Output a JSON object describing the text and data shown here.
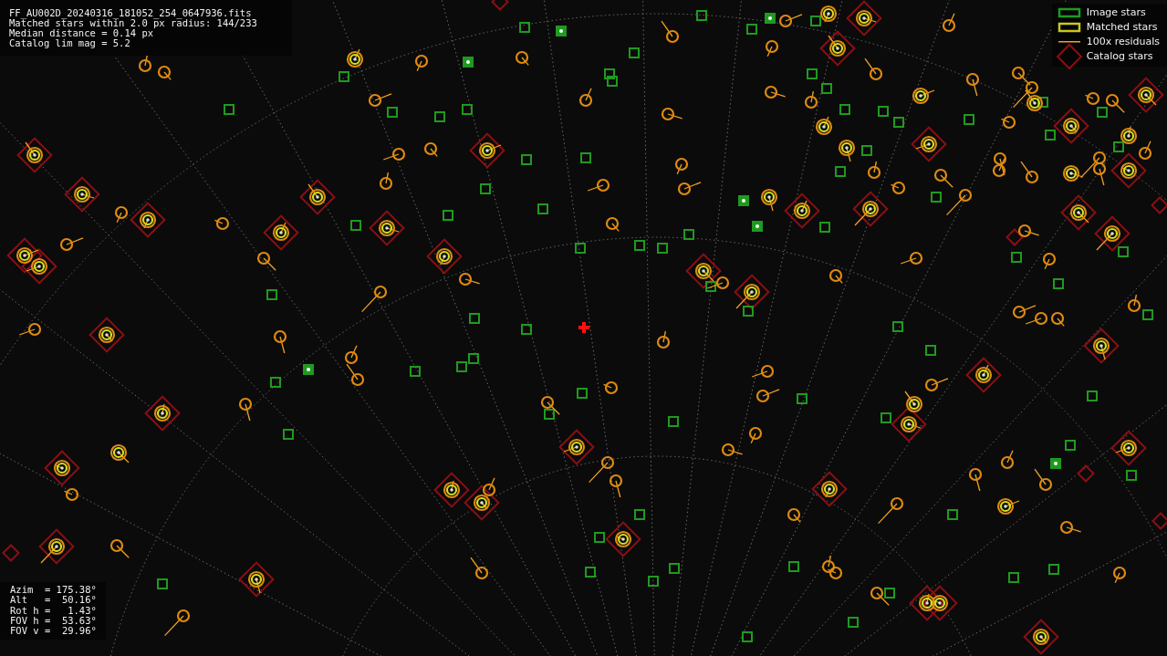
{
  "info_panel": {
    "lines": [
      "FF_AU002D_20240316_181052_254_0647936.fits",
      "Matched stars within 2.0 px radius: 144/233",
      "Median distance = 0.14 px",
      "Catalog lim mag = 5.2"
    ]
  },
  "legend": [
    {
      "kind": "image",
      "label": "Image stars"
    },
    {
      "kind": "matched",
      "label": "Matched stars"
    },
    {
      "kind": "residual",
      "label": "100x residuals"
    },
    {
      "kind": "catalog",
      "label": "Catalog stars"
    }
  ],
  "pointing_panel": {
    "lines": [
      "Azim  = 175.38°",
      "Alt   =  50.16°",
      "Rot h =   1.43°",
      "FOV h =  53.63°",
      "FOV v =  29.96°"
    ]
  }
}
